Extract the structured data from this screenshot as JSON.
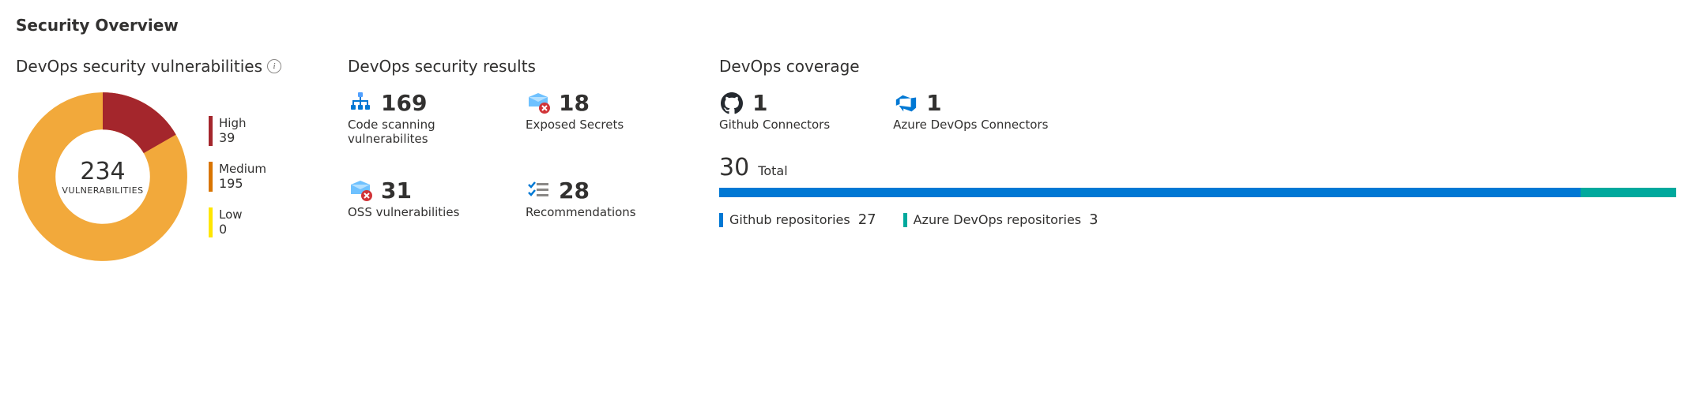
{
  "title": "Security Overview",
  "colors": {
    "high": "#a4262c",
    "medium": "#d97500",
    "low": "#ffe600",
    "donut": "#f2a93b",
    "blue": "#0078d4",
    "devops": "#0099bc",
    "teal": "#00a99d"
  },
  "vulnerabilities": {
    "title": "DevOps security vulnerabilities",
    "total": "234",
    "total_label": "VULNERABILITIES",
    "legend": [
      {
        "label": "High",
        "value": "39",
        "colorKey": "high"
      },
      {
        "label": "Medium",
        "value": "195",
        "colorKey": "medium"
      },
      {
        "label": "Low",
        "value": "0",
        "colorKey": "low"
      }
    ]
  },
  "results": {
    "title": "DevOps security results",
    "items": [
      {
        "value": "169",
        "label": "Code scanning vulnerabilites"
      },
      {
        "value": "18",
        "label": "Exposed Secrets"
      },
      {
        "value": "31",
        "label": "OSS vulnerabilities"
      },
      {
        "value": "28",
        "label": "Recommendations"
      }
    ]
  },
  "coverage": {
    "title": "DevOps coverage",
    "connectors": [
      {
        "value": "1",
        "label": "Github Connectors"
      },
      {
        "value": "1",
        "label": "Azure DevOps Connectors"
      }
    ],
    "total": {
      "value": "30",
      "label": "Total"
    },
    "breakdown": [
      {
        "label": "Github repositories",
        "value": "27",
        "colorKey": "blue"
      },
      {
        "label": "Azure DevOps repositories",
        "value": "3",
        "colorKey": "teal"
      }
    ]
  },
  "chart_data": [
    {
      "type": "pie",
      "title": "DevOps security vulnerabilities",
      "categories": [
        "High",
        "Medium",
        "Low"
      ],
      "values": [
        39,
        195,
        0
      ],
      "total": 234
    },
    {
      "type": "bar",
      "title": "DevOps coverage — repositories",
      "categories": [
        "Github repositories",
        "Azure DevOps repositories"
      ],
      "values": [
        27,
        3
      ],
      "total": 30
    }
  ]
}
